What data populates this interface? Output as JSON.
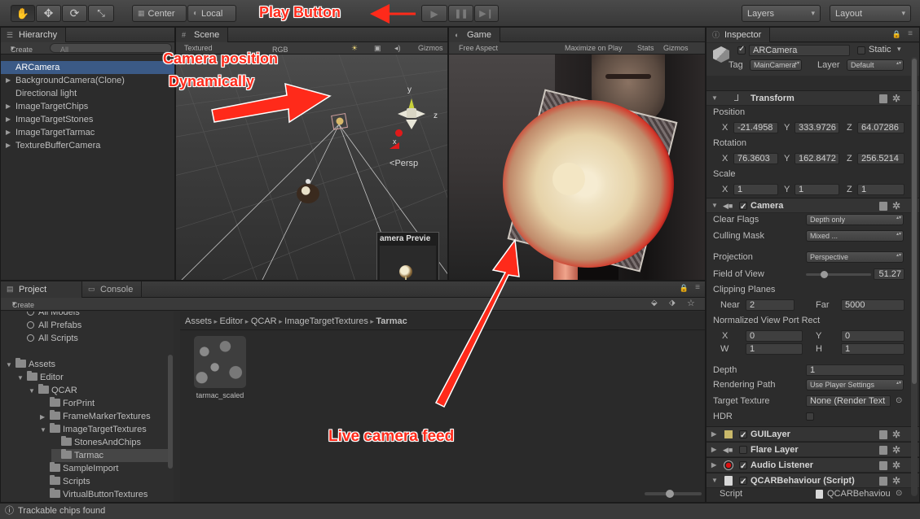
{
  "toolbar": {
    "pivot_center": "Center",
    "pivot_local": "Local",
    "layers": "Layers",
    "layout": "Layout"
  },
  "hierarchy": {
    "tab": "Hierarchy",
    "create": "Create",
    "search_placeholder": "All",
    "items": [
      {
        "label": "ARCamera"
      },
      {
        "label": "BackgroundCamera(Clone)"
      },
      {
        "label": "Directional light"
      },
      {
        "label": "ImageTargetChips"
      },
      {
        "label": "ImageTargetStones"
      },
      {
        "label": "ImageTargetTarmac"
      },
      {
        "label": "TextureBufferCamera"
      }
    ]
  },
  "scene": {
    "tab": "Scene",
    "shading": "Textured",
    "render": "RGB",
    "gizmos": "Gizmos",
    "axis_y": "y",
    "axis_z": "z",
    "axis_x": "x",
    "persp": "Persp",
    "camera_preview": "amera Previe"
  },
  "game": {
    "tab": "Game",
    "aspect": "Free Aspect",
    "maximize": "Maximize on Play",
    "stats": "Stats",
    "gizmos": "Gizmos"
  },
  "project": {
    "tab": "Project",
    "console_tab": "Console",
    "create": "Create",
    "favorites": [
      "All Models",
      "All Prefabs",
      "All Scripts"
    ],
    "tree": [
      {
        "label": "Assets"
      },
      {
        "label": "Editor"
      },
      {
        "label": "QCAR"
      },
      {
        "label": "ForPrint"
      },
      {
        "label": "FrameMarkerTextures"
      },
      {
        "label": "ImageTargetTextures"
      },
      {
        "label": "StonesAndChips"
      },
      {
        "label": "Tarmac"
      },
      {
        "label": "SampleImport"
      },
      {
        "label": "Scripts"
      },
      {
        "label": "VirtualButtonTextures"
      }
    ],
    "breadcrumb": [
      "Assets",
      "Editor",
      "QCAR",
      "ImageTargetTextures",
      "Tarmac"
    ],
    "asset_label": "tarmac_scaled"
  },
  "inspector": {
    "tab": "Inspector",
    "object_name": "ARCamera",
    "static_label": "Static",
    "tag_label": "Tag",
    "tag_value": "MainCamera",
    "layer_label": "Layer",
    "layer_value": "Default",
    "transform": {
      "title": "Transform",
      "position_label": "Position",
      "position": {
        "x": "-21.4958",
        "y": "333.9726",
        "z": "64.07286"
      },
      "rotation_label": "Rotation",
      "rotation": {
        "x": "76.3603",
        "y": "162.8472",
        "z": "256.5214"
      },
      "scale_label": "Scale",
      "scale": {
        "x": "1",
        "y": "1",
        "z": "1"
      }
    },
    "camera": {
      "title": "Camera",
      "clear_flags_label": "Clear Flags",
      "clear_flags": "Depth only",
      "culling_mask_label": "Culling Mask",
      "culling_mask": "Mixed ...",
      "projection_label": "Projection",
      "projection": "Perspective",
      "fov_label": "Field of View",
      "fov": "51.27",
      "fov_fraction": 0.28,
      "clipping_label": "Clipping Planes",
      "near_label": "Near",
      "near": "2",
      "far_label": "Far",
      "far": "5000",
      "viewport_label": "Normalized View Port Rect",
      "vp_x_label": "X",
      "vp_x": "0",
      "vp_y_label": "Y",
      "vp_y": "0",
      "vp_w_label": "W",
      "vp_w": "1",
      "vp_h_label": "H",
      "vp_h": "1",
      "depth_label": "Depth",
      "depth": "1",
      "rendering_path_label": "Rendering Path",
      "rendering_path": "Use Player Settings",
      "target_texture_label": "Target Texture",
      "target_texture": "None (Render Text",
      "hdr_label": "HDR"
    },
    "components": [
      {
        "label": "GUILayer"
      },
      {
        "label": "Flare Layer"
      },
      {
        "label": "Audio Listener"
      },
      {
        "label": "QCARBehaviour (Script)"
      }
    ],
    "script_label": "Script",
    "script_value": "QCARBehaviou"
  },
  "status": {
    "text": "Trackable chips found"
  },
  "annotations": {
    "play_button": "Play Button",
    "camera_position_line1": "Camera position",
    "camera_position_line2": "Dynamically",
    "live_feed": "Live camera feed"
  },
  "colors": {
    "annotation": "#ff2a1a",
    "selection": "#3b5a86",
    "panel_bg": "#2c2c2c"
  }
}
